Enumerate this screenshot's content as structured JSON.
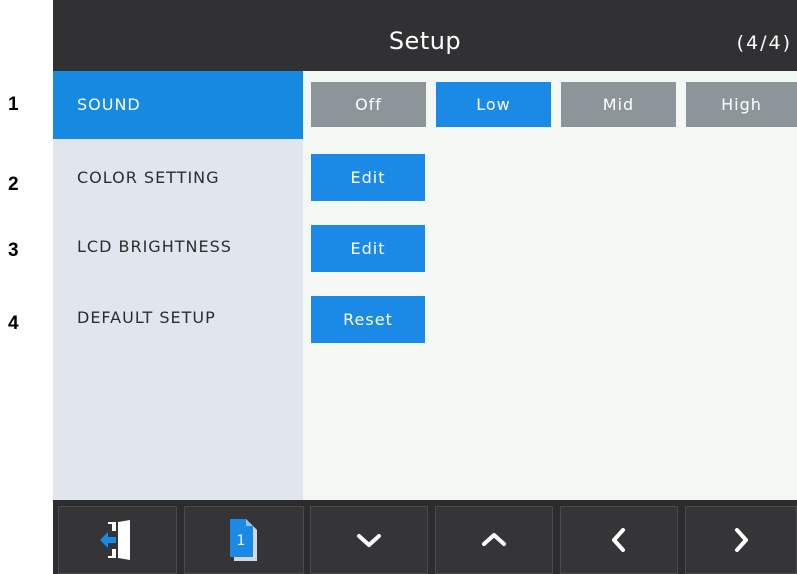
{
  "row_numbers": [
    "1",
    "2",
    "3",
    "4"
  ],
  "header": {
    "title": "Setup",
    "page_indicator": "(4/4)"
  },
  "menu": {
    "items": [
      {
        "label": "SOUND",
        "active": true
      },
      {
        "label": "COLOR SETTING",
        "active": false
      },
      {
        "label": "LCD BRIGHTNESS",
        "active": false
      },
      {
        "label": "DEFAULT SETUP",
        "active": false
      }
    ]
  },
  "sound": {
    "options": [
      "Off",
      "Low",
      "Mid",
      "High"
    ],
    "selected": "Low"
  },
  "actions": {
    "color_setting": "Edit",
    "lcd_brightness": "Edit",
    "default_setup": "Reset"
  },
  "toolbar": {
    "buttons": [
      {
        "icon": "exit-door-icon"
      },
      {
        "icon": "page-one-icon",
        "label": "1"
      },
      {
        "icon": "chevron-down-icon"
      },
      {
        "icon": "chevron-up-icon"
      },
      {
        "icon": "chevron-left-icon"
      },
      {
        "icon": "chevron-right-icon"
      }
    ]
  },
  "colors": {
    "accent": "#1a8ae6",
    "selected_menu": "#1689e0",
    "title_bar": "#313133",
    "sidebar": "#e1e6ee",
    "content": "#f4f8f4",
    "unselected_option": "#8c969a"
  }
}
